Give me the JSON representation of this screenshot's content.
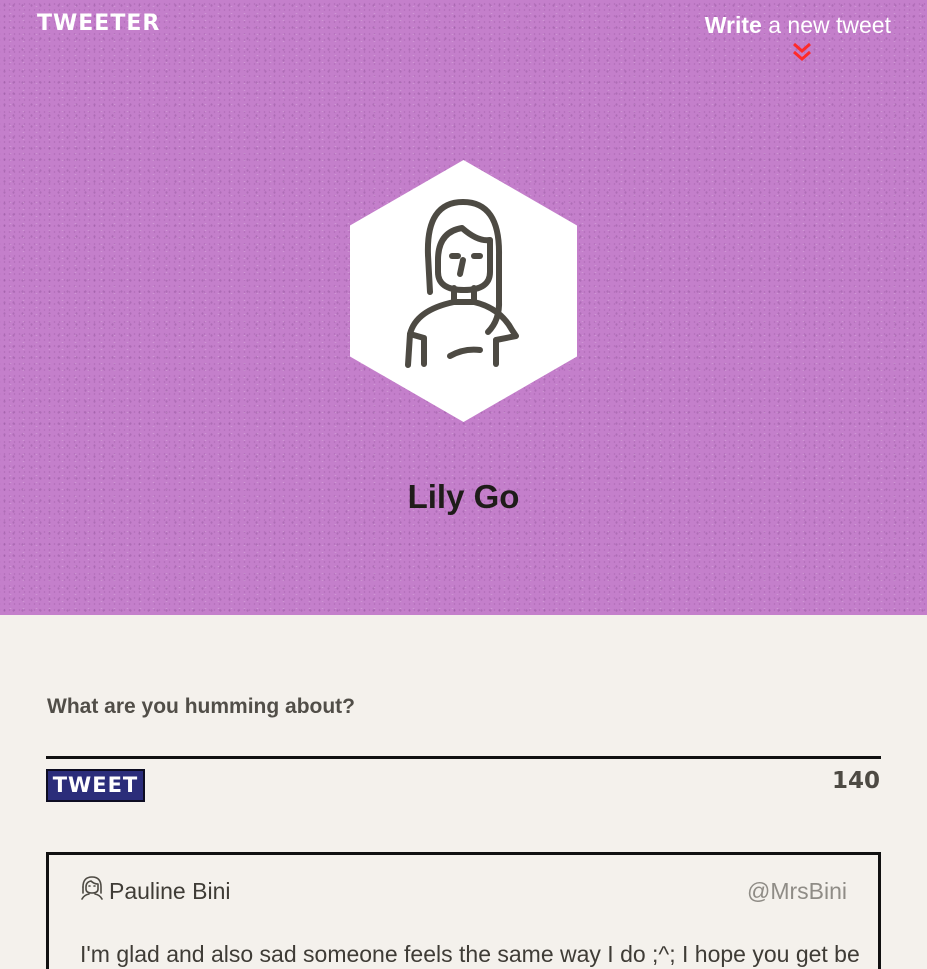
{
  "header": {
    "brand": "TWEETER",
    "write_strong": "Write",
    "write_rest": " a new tweet",
    "chevron_icon": "double-chevron-down-icon",
    "accent_color": "#ff2a2a",
    "background_color": "#c47fcb"
  },
  "profile": {
    "name": "Lily Go",
    "avatar_icon": "woman-avatar-icon"
  },
  "compose": {
    "placeholder": "What are you humming about?",
    "button_label": "TWEET",
    "char_count": "140",
    "button_color": "#2b2d7a"
  },
  "tweets": [
    {
      "author": "Pauline Bini",
      "handle": "@MrsBini",
      "avatar_icon": "woman-avatar-icon",
      "text": "I'm glad and also sad someone feels the same way I do ;^; I hope you get better"
    }
  ]
}
